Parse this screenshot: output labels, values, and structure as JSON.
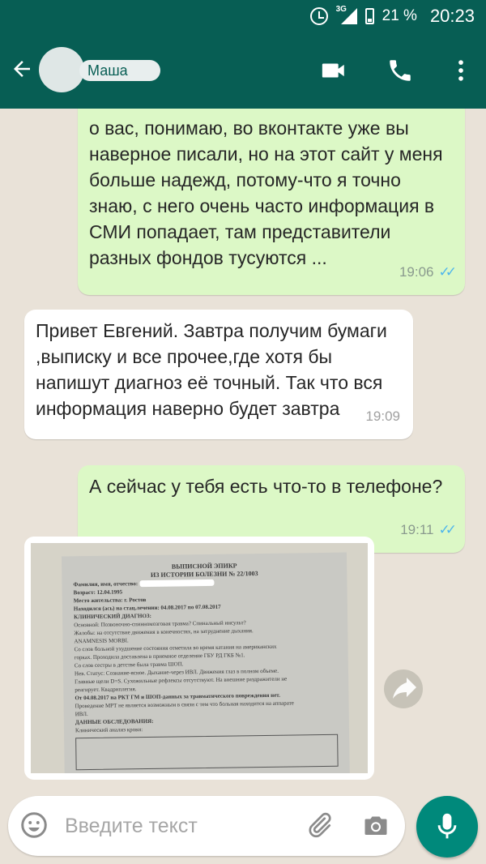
{
  "status_bar": {
    "network": "3G",
    "battery": "21 %",
    "time": "20:23"
  },
  "header": {
    "contact_name": "Маша"
  },
  "messages": [
    {
      "direction": "outgoing",
      "text": "о вас, понимаю, во вконтакте уже вы наверное писали, но на этот сайт у меня больше надежд, потому-что я точно знаю, с него очень часто информация в СМИ попадает, там представители разных фондов тусуются ...",
      "time": "19:06",
      "status": "read"
    },
    {
      "direction": "incoming",
      "text": "Привет Евгений. Завтра получим бумаги ,выписку и все прочее,где хотя бы напишут диагноз её точный. Так что вся информация наверно будет завтра",
      "time": "19:09"
    },
    {
      "direction": "outgoing",
      "text": "А сейчас у тебя есть что-то в телефоне?",
      "time": "19:11",
      "status": "read"
    }
  ],
  "photo_doc": {
    "title_line1": "ВЫПИСНОЙ ЭПИКР",
    "title_line2": "ИЗ ИСТОРИИ БОЛЕЗНИ № 22/1003",
    "fio_label": "Фамилия, имя, отчество:",
    "dob": "Возраст: 12.04.1995",
    "residence": "Место жительства: г. Ростов",
    "stay": "Находился (ась) на стац.лечении: 04.08.2017 по 07.08.2017",
    "diag_title": "КЛИНИЧЕСКИЙ ДИАГНОЗ:",
    "diag_main": "Основной: Позвоночно-спинномозговая травма? Спинальный инсульт?",
    "complaints": "Жалобы: на отсутствие движения в конечностях, на затруднение дыхания.",
    "anamnesis": "ANAMNESIS MORBI.",
    "anam_1": "Со слов больной ухудшение состояния отметила во время катания на американских",
    "anam_2": "горках. Проходила доставлена в приемное отделение ГБУ РД ГКБ №1.",
    "anam_3": "Со слов сестры в детстве была травма ШОП.",
    "status_1": "Нев. Статус: Сознание-ясное. Дыхание-через ИВЛ. Движения глаз в полном объеме.",
    "status_2": "Главные щели D=S. Сухожильные рефлексы отсутствуют. На внешние раздражители не",
    "status_3": "реагирует. Квадриплегия.",
    "mrt_1": "От 04.08.2017 на РКТ ГМ и ШОП-данных за травматического повреждения нет.",
    "mrt_2": "Проведение МРТ не является возможным в связи с тем что больная находится на аппарате",
    "mrt_3": "ИВЛ.",
    "exam_title": "ДАННЫЕ ОБСЛЕДОВАНИЯ:",
    "exam_sub": "Клинический анализ крови:"
  },
  "composer": {
    "placeholder": "Введите текст"
  },
  "icons": {
    "back": "back-arrow-icon",
    "video": "video-call-icon",
    "call": "phone-icon",
    "menu": "more-vert-icon",
    "share": "forward-icon",
    "emoji": "emoji-icon",
    "attach": "paperclip-icon",
    "camera": "camera-icon",
    "mic": "microphone-icon"
  },
  "colors": {
    "header": "#075e54",
    "outgoing_bubble": "#dcf8c6",
    "incoming_bubble": "#ffffff",
    "read_ticks": "#4fb6ec",
    "mic_button": "#00897b"
  }
}
